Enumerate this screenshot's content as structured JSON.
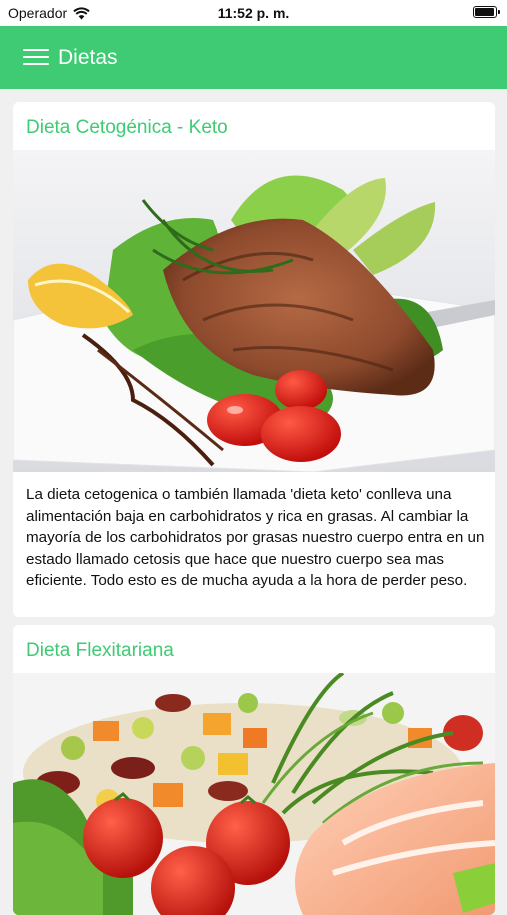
{
  "status_bar": {
    "carrier": "Operador",
    "time": "11:52 p. m.",
    "battery_level": 0.85
  },
  "appbar": {
    "title": "Dietas",
    "menu_icon": "hamburger-menu-icon",
    "accent": "#3ecb74"
  },
  "cards": [
    {
      "title": "Dieta Cetogénica - Keto",
      "image": "grilled-salmon-salad-photo",
      "description": "La dieta cetogenica o también llamada 'dieta keto' conlleva una alimentación baja en carbohidratos y rica en grasas. Al cambiar la mayoría de los carbohidratos por grasas nuestro cuerpo entra en un estado llamado cetosis que hace que nuestro cuerpo sea mas eficiente. Todo esto es de mucha ayuda a la hora de perder peso."
    },
    {
      "title": "Dieta Flexitariana",
      "image": "vegetable-salad-salmon-photo"
    }
  ]
}
